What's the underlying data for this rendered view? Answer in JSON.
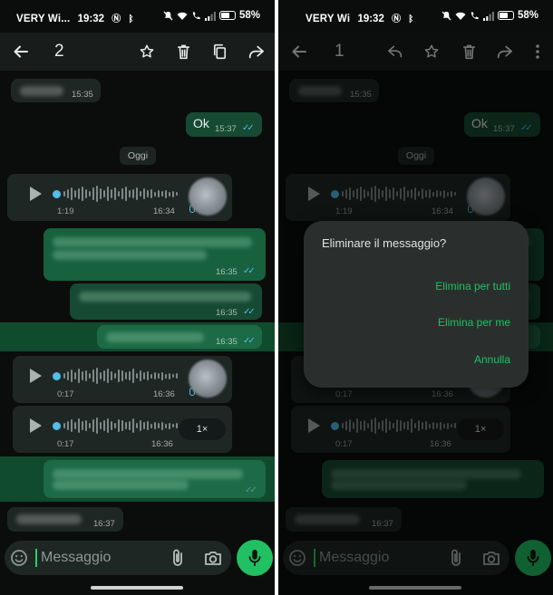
{
  "status": {
    "carrier": "VERY Wi",
    "carrier_left_full": "VERY Wi...",
    "time": "19:32",
    "battery": "58%"
  },
  "left": {
    "selected_count": "2",
    "messages": {
      "m1_time": "15:35",
      "ok_text": "Ok",
      "ok_time": "15:37",
      "date_chip": "Oggi",
      "voice1_duration": "1:19",
      "voice1_time": "16:34",
      "out1_time": "16:35",
      "out2_time": "16:35",
      "out3_time": "16:35",
      "voice2_duration": "0:17",
      "voice2_time": "16:36",
      "voice3_duration": "0:17",
      "voice3_time": "16:36",
      "voice3_speed": "1×",
      "last_time": "16:37"
    },
    "input_placeholder": "Messaggio"
  },
  "right": {
    "selected_count": "1",
    "messages": {
      "m1_time": "15:35",
      "ok_text": "Ok",
      "ok_time": "15:37",
      "date_chip": "Oggi",
      "voice1_duration": "1:19",
      "voice1_time": "16:34",
      "voice2_duration": "0:17",
      "voice2_time": "16:36",
      "voice3_duration": "0:17",
      "voice3_time": "16:36",
      "voice3_speed": "1×",
      "last_time": "16:37"
    },
    "input_placeholder": "Messaggio",
    "dialog": {
      "title": "Eliminare il messaggio?",
      "delete_for_all": "Elimina per tutti",
      "delete_for_me": "Elimina per me",
      "cancel": "Annulla"
    }
  },
  "icons": {
    "back": "arrow-left-icon",
    "reply": "reply-icon",
    "star": "star-icon",
    "delete": "trash-icon",
    "copy": "copy-icon",
    "forward": "forward-icon",
    "more": "more-vertical-icon",
    "emoji": "sticker-icon",
    "attach": "paperclip-icon",
    "camera": "camera-icon",
    "mic": "mic-icon"
  },
  "colors": {
    "accent_green": "#21c063",
    "outgoing_bubble": "#164a33",
    "incoming_bubble": "#1f2725",
    "read_ticks": "#53bdeb",
    "selection_highlight": "#157f48"
  }
}
